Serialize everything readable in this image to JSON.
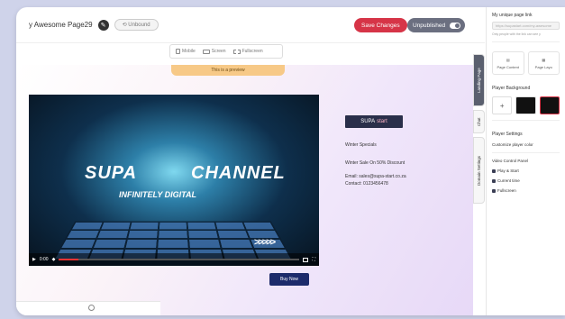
{
  "topbar": {
    "page_title": "y Awesome Page29",
    "unbound_label": "Unbound",
    "save_label": "Save Changes",
    "unpublished_label": "Unpublished"
  },
  "devices": {
    "mobile": "Mobile",
    "screen": "Screen",
    "fullscreen": "Fullscreen"
  },
  "preview": {
    "banner": "This is a preview",
    "video": {
      "brand_left": "SUPA",
      "brand_right": "CHANNEL",
      "tagline": "INFINITELY DIGITAL",
      "time": "0:00",
      "progress": 0.08
    },
    "buy_label": "Buy Now",
    "logo_a": "SUPA",
    "logo_b": "start",
    "line1": "Winter Specials",
    "line2": "Winter Sale On 50% Discount",
    "line3": "Email: sales@supa-start.co.za",
    "line4": "Contact: 0123456478"
  },
  "sidetabs": {
    "landing": "Landing Page",
    "chat": "Chat",
    "domain": "Domain Settings"
  },
  "panel": {
    "url_label": "My unique page link",
    "url_placeholder": "https://supastart.com/my-awesome",
    "url_hint": "Only people with the link can see y",
    "card1": "Page Content",
    "card2": "Page Layo",
    "bg_label": "Player Background",
    "settings_label": "Player Settings",
    "customise_label": "Customize player color",
    "vcp_label": "Video Control Panel",
    "opt1": "Play & Start",
    "opt2": "Current time",
    "opt3": "Fullscreen"
  },
  "colors": {
    "accent": "#d63447",
    "navy": "#1d2b6b"
  }
}
